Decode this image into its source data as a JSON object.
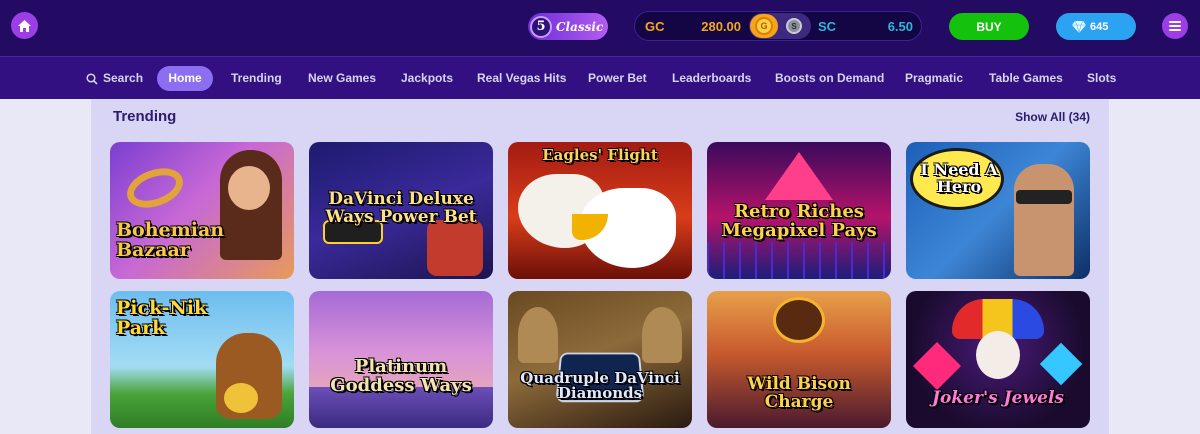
{
  "header": {
    "logo_text": "Classic",
    "logo_number": "5",
    "wallet": {
      "gc_label": "GC",
      "gc_value": "280.00",
      "sc_label": "SC",
      "sc_value": "6.50",
      "gc_coin": "G",
      "sc_coin": "S"
    },
    "buy_label": "BUY",
    "gems_value": "645"
  },
  "nav": {
    "items": [
      {
        "label": "Search"
      },
      {
        "label": "Home"
      },
      {
        "label": "Trending"
      },
      {
        "label": "New Games"
      },
      {
        "label": "Jackpots"
      },
      {
        "label": "Real Vegas Hits"
      },
      {
        "label": "Power Bet"
      },
      {
        "label": "Leaderboards"
      },
      {
        "label": "Boosts on Demand"
      },
      {
        "label": "Pragmatic"
      },
      {
        "label": "Table Games"
      },
      {
        "label": "Slots"
      }
    ],
    "active": "Home"
  },
  "section": {
    "title": "Trending",
    "show_all": "Show All (34)"
  },
  "games": [
    {
      "title": "Bohemian Bazaar"
    },
    {
      "title": "DaVinci Deluxe Ways Power Bet"
    },
    {
      "title": "Eagles' Flight"
    },
    {
      "title": "Retro Riches Megapixel Pays"
    },
    {
      "title": "I Need A Hero"
    },
    {
      "title": "Pick-Nik Park"
    },
    {
      "title": "Platinum Goddess Ways"
    },
    {
      "title": "Quadruple DaVinci Diamonds"
    },
    {
      "title": "Wild Bison Charge"
    },
    {
      "title": "Joker's Jewels"
    }
  ],
  "colors": {
    "topbar": "#230a63",
    "navbar": "#321081",
    "accent": "#9b3ee6",
    "buy": "#14c10d",
    "gems": "#2ca3f0",
    "gc": "#f2a81d",
    "sc": "#2fb6d8"
  }
}
